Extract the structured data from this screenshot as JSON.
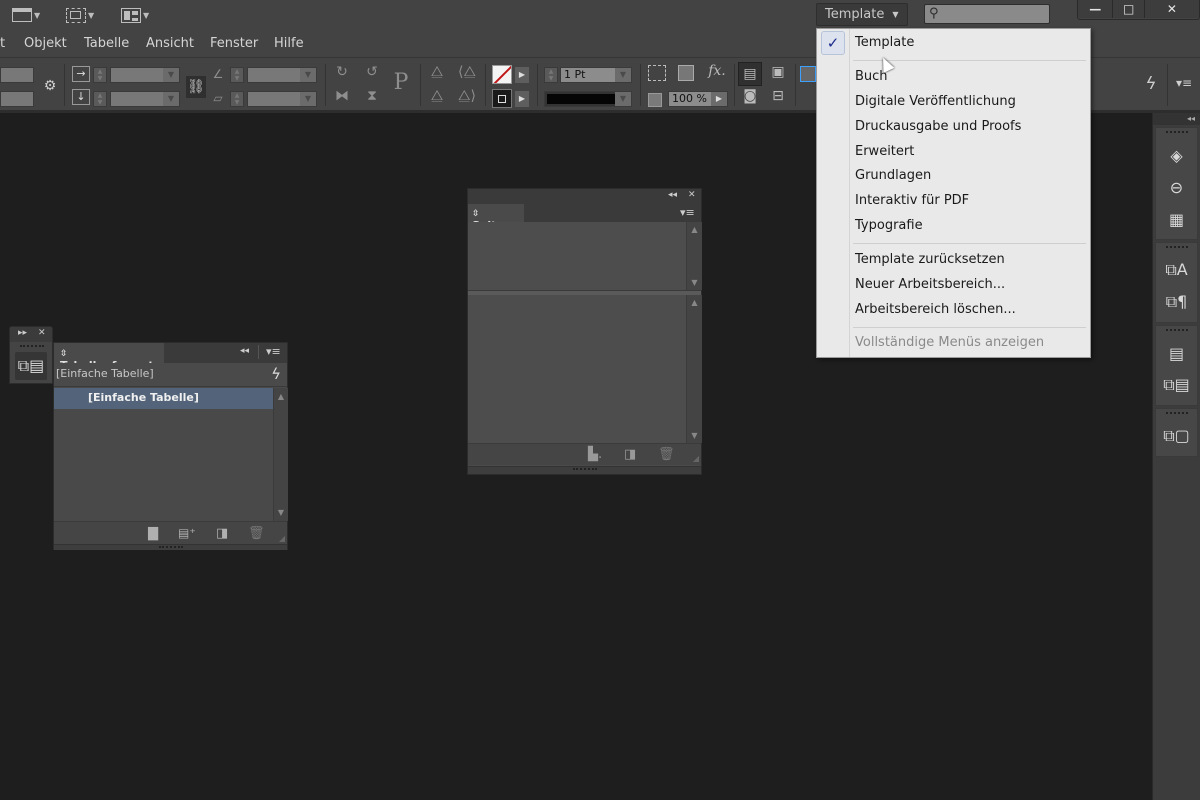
{
  "titlebar": {
    "workspace_button_label": "Template",
    "search_placeholder": "",
    "window_controls": {
      "minimize": "—",
      "maximize": "□",
      "close": "✕"
    }
  },
  "menubar": {
    "items": [
      "t",
      "Objekt",
      "Tabelle",
      "Ansicht",
      "Fenster",
      "Hilfe"
    ]
  },
  "controlbar": {
    "stroke_weight": "1 Pt",
    "opacity": "100 %"
  },
  "workspace_menu": {
    "checked_item": "Template",
    "groups": [
      [
        "Template"
      ],
      [
        "Buch",
        "Digitale Veröffentlichung",
        "Druckausgabe und Proofs",
        "Erweitert",
        "Grundlagen",
        "Interaktiv für PDF",
        "Typografie"
      ],
      [
        "Template zurücksetzen",
        "Neuer Arbeitsbereich...",
        "Arbeitsbereich löschen..."
      ],
      [
        "Vollständige Menüs anzeigen"
      ]
    ],
    "disabled": [
      "Vollständige Menüs anzeigen"
    ]
  },
  "panels": {
    "tabellenformate": {
      "tab_label": "Tabellenformate",
      "current_style": "[Einfache Tabelle]",
      "items": [
        "[Einfache Tabelle]"
      ],
      "selected_index": 0
    },
    "seiten": {
      "tab_label": "Seiten"
    }
  },
  "right_dock": {
    "groups": [
      [
        "layers-icon",
        "links-icon",
        "swatches-grid-icon"
      ],
      [
        "character-styles-icon",
        "paragraph-styles-icon"
      ],
      [
        "table-icon",
        "cell-styles-icon"
      ],
      [
        "object-styles-icon"
      ]
    ]
  }
}
